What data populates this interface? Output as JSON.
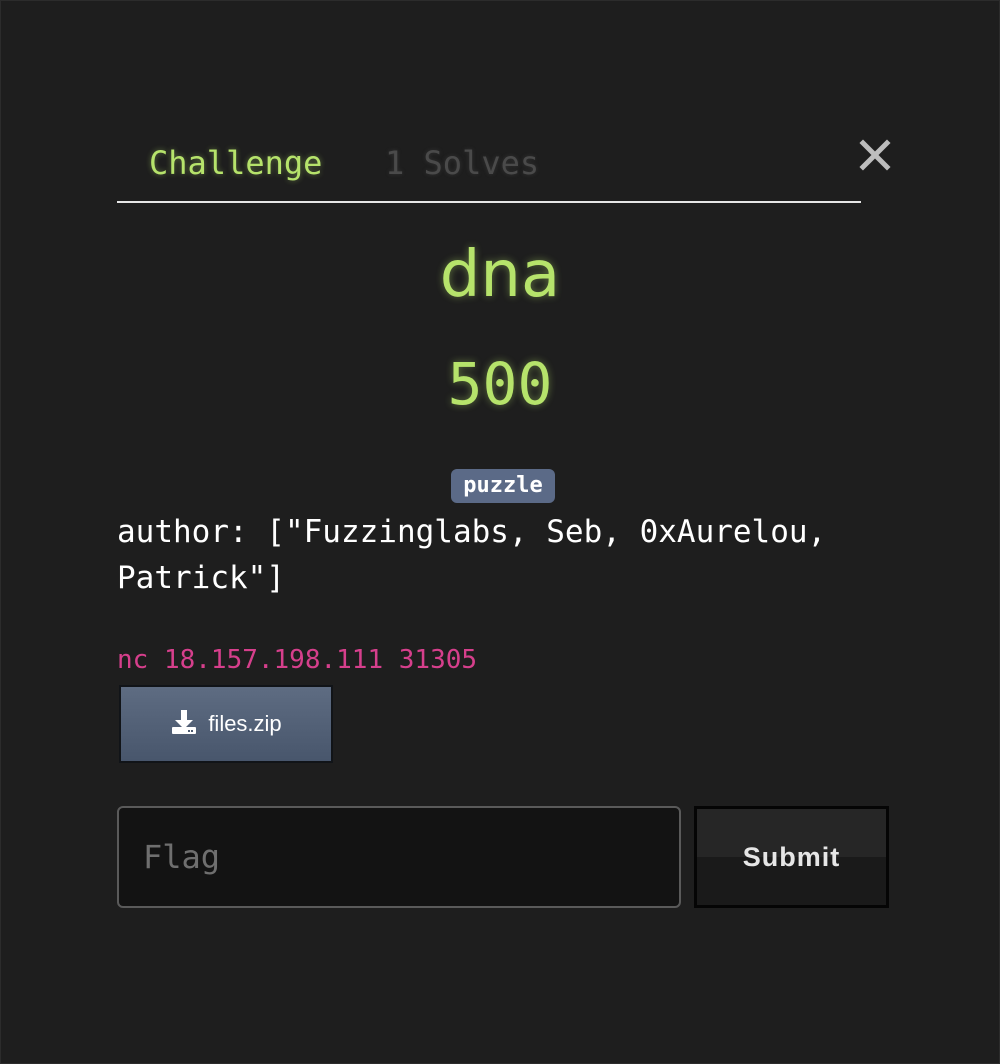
{
  "tabs": {
    "challenge_label": "Challenge",
    "solves_label": "1 Solves"
  },
  "close_icon": "close-icon",
  "challenge": {
    "name": "dna",
    "points": "500",
    "tag": "puzzle",
    "description": "author: [\"Fuzzinglabs, Seb, 0xAurelou,\nPatrick\"]",
    "connection": "nc 18.157.198.111 31305"
  },
  "files": [
    {
      "label": "files.zip",
      "icon": "download-icon"
    }
  ],
  "flag_form": {
    "placeholder": "Flag",
    "value": "",
    "submit_label": "Submit"
  },
  "colors": {
    "accent": "#b6e36b",
    "link": "#d63f8c",
    "tag_bg": "#5b6a87",
    "background": "#1e1e1e"
  }
}
